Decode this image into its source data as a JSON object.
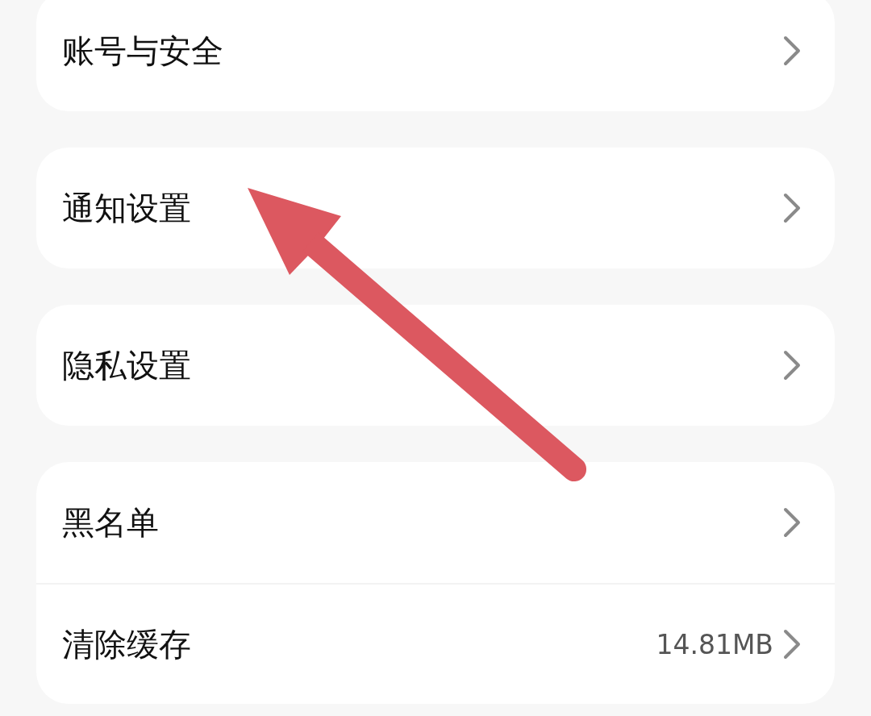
{
  "groups": [
    {
      "items": [
        {
          "label": "账号与安全"
        }
      ]
    },
    {
      "items": [
        {
          "label": "通知设置"
        }
      ]
    },
    {
      "items": [
        {
          "label": "隐私设置"
        }
      ]
    },
    {
      "items": [
        {
          "label": "黑名单"
        },
        {
          "label": "清除缓存",
          "value": "14.81MB"
        }
      ]
    }
  ]
}
